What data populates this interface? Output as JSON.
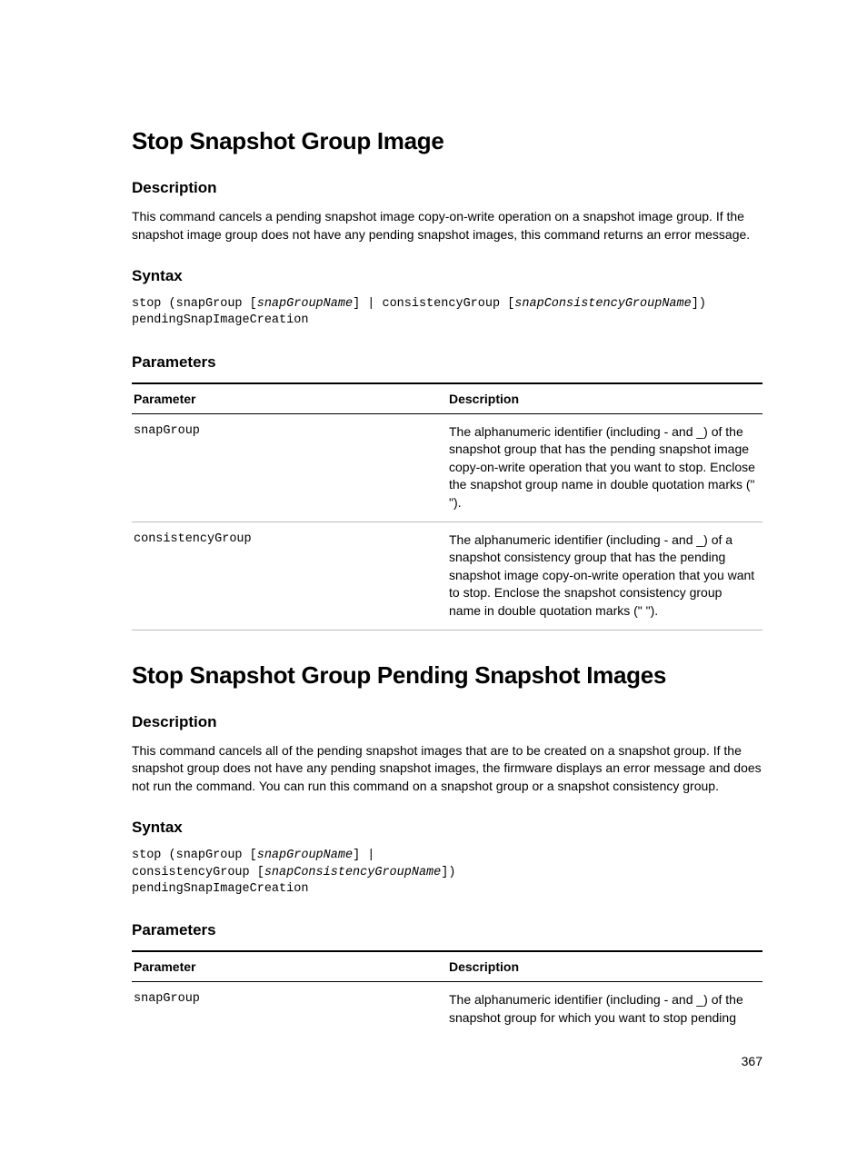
{
  "page_number": "367",
  "section1": {
    "title": "Stop Snapshot Group Image",
    "desc_heading": "Description",
    "desc_body": "This command cancels a pending snapshot image copy-on-write operation on a snapshot image group. If the snapshot image group does not have any pending snapshot images, this command returns an error message.",
    "syntax_heading": "Syntax",
    "syntax_plain1_a": "stop (snapGroup [",
    "syntax_var1": "snapGroupName",
    "syntax_plain1_b": "] | consistencyGroup [",
    "syntax_var2": "snapConsistencyGroupName",
    "syntax_plain1_c": "])",
    "syntax_plain2": "pendingSnapImageCreation",
    "params_heading": "Parameters",
    "table": {
      "col_param": "Parameter",
      "col_desc": "Description",
      "rows": [
        {
          "name": "snapGroup",
          "desc": "The alphanumeric identifier (including - and _) of the snapshot group that has the pending snapshot image copy-on-write operation that you want to stop. Enclose the snapshot group name in double quotation marks (\" \")."
        },
        {
          "name": "consistencyGroup",
          "desc": "The alphanumeric identifier (including - and _) of a snapshot consistency group that has the pending snapshot image copy-on-write operation that you want to stop. Enclose the snapshot consistency group name in double quotation marks (\" \")."
        }
      ]
    }
  },
  "section2": {
    "title": "Stop Snapshot Group Pending Snapshot Images",
    "desc_heading": "Description",
    "desc_body": "This command cancels all of the pending snapshot images that are to be created on a snapshot group. If the snapshot group does not have any pending snapshot images, the firmware displays an error message and does not run the command. You can run this command on a snapshot group or a snapshot consistency group.",
    "syntax_heading": "Syntax",
    "syntax_plain1_a": "stop (snapGroup [",
    "syntax_var1": "snapGroupName",
    "syntax_plain1_b": "] |",
    "syntax_plain2_a": "consistencyGroup [",
    "syntax_var2": "snapConsistencyGroupName",
    "syntax_plain2_b": "])",
    "syntax_plain3": "pendingSnapImageCreation",
    "params_heading": "Parameters",
    "table": {
      "col_param": "Parameter",
      "col_desc": "Description",
      "rows": [
        {
          "name": "snapGroup",
          "desc": "The alphanumeric identifier (including - and _) of the snapshot group for which you want to stop pending"
        }
      ]
    }
  }
}
